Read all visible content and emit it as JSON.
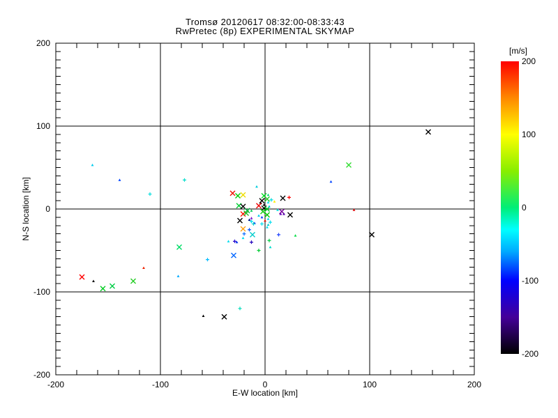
{
  "chart_data": {
    "type": "scatter",
    "title_line1": "Tromsø 20120617 08:32:00-08:33:43",
    "title_line2": "RwPretec (8p) EXPERIMENTAL SKYMAP",
    "xlabel": "E-W location [km]",
    "ylabel": "N-S location [km]",
    "xlim": [
      -200,
      200
    ],
    "ylim": [
      -200,
      200
    ],
    "x_major_ticks": [
      -200,
      -100,
      0,
      100,
      200
    ],
    "y_major_ticks": [
      200,
      100,
      0,
      -100,
      -200
    ],
    "x_minor_step": 20,
    "y_minor_step": 10,
    "grid": true,
    "frame_color": "#000000",
    "background_color": "#ffffff",
    "colorbar": {
      "unit_label": "[m/s]",
      "max": 200,
      "min": -200,
      "ticks": [
        200,
        100,
        0,
        -100,
        -200
      ],
      "stops": [
        {
          "value": 200,
          "color": "#ff0000"
        },
        {
          "value": 150,
          "color": "#ff8800"
        },
        {
          "value": 100,
          "color": "#ffff00"
        },
        {
          "value": 50,
          "color": "#88ee00"
        },
        {
          "value": 0,
          "color": "#00ee77"
        },
        {
          "value": -30,
          "color": "#00ffff"
        },
        {
          "value": -60,
          "color": "#00aaff"
        },
        {
          "value": -100,
          "color": "#0000ff"
        },
        {
          "value": -150,
          "color": "#440099"
        },
        {
          "value": -200,
          "color": "#000000"
        }
      ]
    },
    "points": [
      [
        -165,
        53,
        "dot",
        "#00ccee"
      ],
      [
        -139,
        35,
        "dot",
        "#0044ff"
      ],
      [
        -110,
        18,
        "plus",
        "#00dddd"
      ],
      [
        -77,
        35,
        "plus",
        "#00ddcc"
      ],
      [
        -175,
        -82,
        "x",
        "#ff0000"
      ],
      [
        -164,
        -87,
        "dot",
        "#000000"
      ],
      [
        -155,
        -96,
        "x",
        "#00cc22"
      ],
      [
        -146,
        -93,
        "x",
        "#00cc44"
      ],
      [
        -126,
        -87,
        "x",
        "#22cc22"
      ],
      [
        -116,
        -71,
        "dot",
        "#ee2200"
      ],
      [
        -82,
        -46,
        "x",
        "#00dd66"
      ],
      [
        -83,
        -81,
        "dot",
        "#00aaff"
      ],
      [
        -55,
        -61,
        "plus",
        "#00bbff"
      ],
      [
        -35,
        -39,
        "dot",
        "#00ddee"
      ],
      [
        -29,
        -39,
        "plus",
        "#2200cc"
      ],
      [
        -30,
        -56,
        "x",
        "#0066ff"
      ],
      [
        -24,
        -120,
        "plus",
        "#00ddbb"
      ],
      [
        -39,
        -130,
        "x",
        "#000000"
      ],
      [
        -59,
        -129,
        "dot",
        "#000000"
      ],
      [
        -31,
        19,
        "x",
        "#ee1100"
      ],
      [
        -26,
        16,
        "x",
        "#00cc00"
      ],
      [
        -21,
        17,
        "x",
        "#eedd00"
      ],
      [
        -8,
        27,
        "dot",
        "#00ccdd"
      ],
      [
        -1,
        16,
        "x",
        "#00dd22"
      ],
      [
        2,
        12,
        "x",
        "#22cc22"
      ],
      [
        3,
        17,
        "dot",
        "#00dd77"
      ],
      [
        6,
        11,
        "plus",
        "#00dddd"
      ],
      [
        9,
        9,
        "dot",
        "#ffee00"
      ],
      [
        -25,
        4,
        "x",
        "#00cc33"
      ],
      [
        -21,
        3,
        "x",
        "#000000"
      ],
      [
        -3,
        10,
        "x",
        "#000000"
      ],
      [
        -4,
        7,
        "dot",
        "#000000"
      ],
      [
        -1,
        5,
        "dot",
        "#000000"
      ],
      [
        -6,
        4,
        "x",
        "#ee0000"
      ],
      [
        -1,
        1,
        "x",
        "#000000"
      ],
      [
        2,
        0,
        "x",
        "#00cc22"
      ],
      [
        -2,
        -3,
        "x",
        "#11cc11"
      ],
      [
        -17,
        -2,
        "x",
        "#00bb44"
      ],
      [
        -13,
        -2,
        "dot",
        "#00cc55"
      ],
      [
        -21,
        -6,
        "x",
        "#ff1100"
      ],
      [
        -18,
        -5,
        "x",
        "#22bb22"
      ],
      [
        2,
        -7,
        "x",
        "#00cc00"
      ],
      [
        -6,
        -8,
        "dot",
        "#00ccee"
      ],
      [
        -3,
        -10,
        "dot",
        "#0033ff"
      ],
      [
        -13,
        -11,
        "dot",
        "#7711cc"
      ],
      [
        3,
        -12,
        "dot",
        "#00ddee"
      ],
      [
        12,
        -1,
        "dot",
        "#00dddd"
      ],
      [
        16,
        -3,
        "x",
        "#770099"
      ],
      [
        24,
        -7,
        "x",
        "#000000"
      ],
      [
        17,
        13,
        "x",
        "#000000"
      ],
      [
        23,
        14,
        "plus",
        "#ff0000"
      ],
      [
        0,
        -14,
        "dot",
        "#ee1100"
      ],
      [
        5,
        -16,
        "plus",
        "#00ddee"
      ],
      [
        3,
        -19,
        "dot",
        "#00cccc"
      ],
      [
        15,
        -6,
        "dot",
        "#6600bb"
      ],
      [
        18,
        -6,
        "dot",
        "#5500aa"
      ],
      [
        3,
        8,
        "dot",
        "#00ddee"
      ],
      [
        4,
        3,
        "dot",
        "#00cccc"
      ],
      [
        -24,
        -14,
        "x",
        "#000000"
      ],
      [
        -15,
        -13,
        "dot",
        "#001188"
      ],
      [
        -10,
        -17,
        "dot",
        "#0044ff"
      ],
      [
        -3,
        -18,
        "plus",
        "#00ddee"
      ],
      [
        -21,
        -24,
        "x",
        "#ff9900"
      ],
      [
        -15,
        -25,
        "plus",
        "#0055ff"
      ],
      [
        -20,
        -30,
        "plus",
        "#0066ff"
      ],
      [
        -12,
        -31,
        "x",
        "#00cccc"
      ],
      [
        13,
        -31,
        "plus",
        "#2244ff"
      ],
      [
        -21,
        -35,
        "dot",
        "#00ddee"
      ],
      [
        -27,
        -40,
        "dot",
        "#0033ee"
      ],
      [
        -13,
        -40,
        "plus",
        "#2200bb"
      ],
      [
        4,
        -38,
        "plus",
        "#00cc44"
      ],
      [
        5,
        -46,
        "dot",
        "#00ddcc"
      ],
      [
        -6,
        -50,
        "plus",
        "#00cc33"
      ],
      [
        29,
        -32,
        "dot",
        "#00dd44"
      ],
      [
        80,
        53,
        "x",
        "#33dd33"
      ],
      [
        63,
        33,
        "dot",
        "#0044ff"
      ],
      [
        85,
        -1,
        "dot",
        "#dd0000"
      ],
      [
        156,
        93,
        "x",
        "#000000"
      ],
      [
        102,
        -31,
        "x",
        "#000000"
      ],
      [
        -13,
        -15,
        "plus",
        "#00ddee"
      ],
      [
        -11,
        -18,
        "plus",
        "#00cccc"
      ],
      [
        2,
        -22,
        "dot",
        "#00ddee"
      ]
    ]
  }
}
